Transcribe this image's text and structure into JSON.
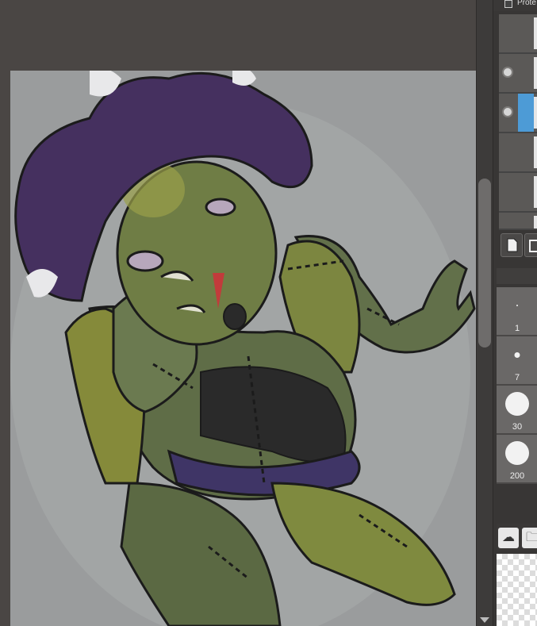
{
  "panel": {
    "protect_label": "Prote",
    "brushes": [
      {
        "size": "1"
      },
      {
        "size": "7"
      },
      {
        "size": "30"
      },
      {
        "size": "200"
      }
    ]
  },
  "canvas": {
    "background_color": "#9a9c9d",
    "skin_color": "#6b7a45",
    "hair_color": "#4a2f6a"
  }
}
